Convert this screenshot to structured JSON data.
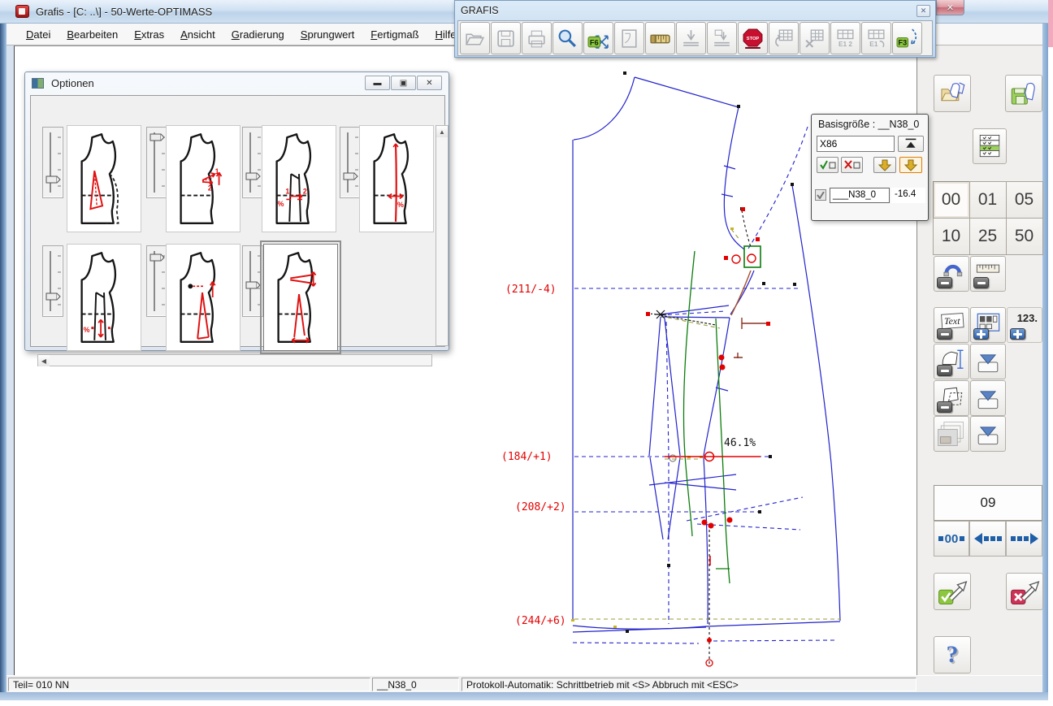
{
  "window": {
    "title": "Grafis - [C: ..\\] - 50-Werte-OPTIMASS",
    "menu_items": [
      {
        "label": "Datei"
      },
      {
        "label": "Bearbeiten"
      },
      {
        "label": "Extras"
      },
      {
        "label": "Ansicht"
      },
      {
        "label": "Gradierung"
      },
      {
        "label": "Sprungwert"
      },
      {
        "label": "Fertigmaß"
      },
      {
        "label": "Hilfe"
      }
    ]
  },
  "grafis_toolbar": {
    "title": "GRAFIS",
    "buttons": [
      {
        "name": "open-file",
        "icon": "open",
        "enabled": false
      },
      {
        "name": "save-file",
        "icon": "save",
        "enabled": false
      },
      {
        "name": "print",
        "icon": "print",
        "enabled": false
      },
      {
        "name": "zoom",
        "icon": "zoom",
        "enabled": true
      },
      {
        "name": "fit-view-f6",
        "icon": "f6",
        "enabled": true,
        "label": "F6"
      },
      {
        "name": "page-preview",
        "icon": "preview",
        "enabled": false
      },
      {
        "name": "measure-tape",
        "icon": "tape",
        "enabled": true
      },
      {
        "name": "insert-measure",
        "icon": "insert1",
        "enabled": false
      },
      {
        "name": "insert-measure-alt",
        "icon": "insert2",
        "enabled": false
      },
      {
        "name": "stop",
        "icon": "stop",
        "enabled": true,
        "label": "STOP"
      },
      {
        "name": "table-reload",
        "icon": "tblrefresh",
        "enabled": false
      },
      {
        "name": "table-delete",
        "icon": "tbldelete",
        "enabled": false
      },
      {
        "name": "table-e12",
        "icon": "tble12",
        "enabled": false,
        "label": "E1 2"
      },
      {
        "name": "table-e1x",
        "icon": "tble1x",
        "enabled": false,
        "label": "E1 "
      },
      {
        "name": "grade-f3",
        "icon": "f3",
        "enabled": true,
        "label": "F3"
      }
    ]
  },
  "optionen": {
    "title": "Optionen",
    "options": [
      {
        "id": 1,
        "name": "dart-with-ghost-panel"
      },
      {
        "id": 2,
        "name": "dart-rotate",
        "marks": [
          "1",
          "2"
        ]
      },
      {
        "id": 3,
        "name": "panel-shift",
        "marks": [
          "1",
          "2",
          "%"
        ]
      },
      {
        "id": 4,
        "name": "length-axis",
        "marks": [
          "%"
        ]
      },
      {
        "id": 5,
        "name": "panel-scale",
        "marks": [
          "%"
        ]
      },
      {
        "id": 6,
        "name": "dart-from-point"
      },
      {
        "id": 7,
        "name": "dart-combined",
        "selected": true
      }
    ]
  },
  "basis_panel": {
    "title": "Basisgröße : __N38_0",
    "size_value": "X86",
    "row": {
      "name": "___N38_0",
      "value": "-16.4",
      "checked": true
    }
  },
  "sidebar": {
    "numbers": [
      "00",
      "01",
      "05",
      "10",
      "25",
      "50"
    ],
    "active_number": "00",
    "numpad_label": "123.",
    "text_label": "Text",
    "step_display": "09",
    "step_zero_label": "00"
  },
  "canvas": {
    "grade_labels": [
      {
        "text": "(211/-4)"
      },
      {
        "text": "(184/+1)"
      },
      {
        "text": "(208/+2)"
      },
      {
        "text": "(244/+6)"
      }
    ],
    "percent_label": "46.1%"
  },
  "statusbar": {
    "part": "Teil= 010 NN",
    "size": "__N38_0",
    "message": "Protokoll-Automatik: Schrittbetrieb mit <S> Abbruch mit <ESC>"
  }
}
